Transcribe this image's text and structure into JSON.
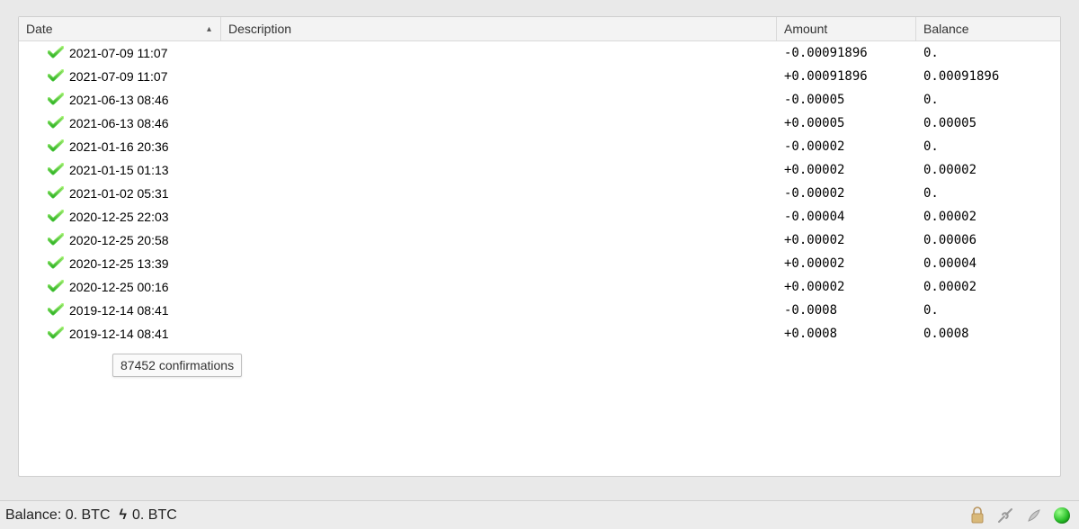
{
  "columns": {
    "date": "Date",
    "description": "Description",
    "amount": "Amount",
    "balance": "Balance"
  },
  "transactions": [
    {
      "date": "2021-07-09 11:07",
      "description": "",
      "amount": "-0.00091896",
      "negative": true,
      "balance": "0."
    },
    {
      "date": "2021-07-09 11:07",
      "description": "",
      "amount": "+0.00091896",
      "negative": false,
      "balance": "0.00091896"
    },
    {
      "date": "2021-06-13 08:46",
      "description": "",
      "amount": "-0.00005",
      "negative": true,
      "balance": "0."
    },
    {
      "date": "2021-06-13 08:46",
      "description": "",
      "amount": "+0.00005",
      "negative": false,
      "balance": "0.00005"
    },
    {
      "date": "2021-01-16 20:36",
      "description": "",
      "amount": "-0.00002",
      "negative": true,
      "balance": "0."
    },
    {
      "date": "2021-01-15 01:13",
      "description": "",
      "amount": "+0.00002",
      "negative": false,
      "balance": "0.00002"
    },
    {
      "date": "2021-01-02 05:31",
      "description": "",
      "amount": "-0.00002",
      "negative": true,
      "balance": "0."
    },
    {
      "date": "2020-12-25 22:03",
      "description": "",
      "amount": "-0.00004",
      "negative": true,
      "balance": "0.00002"
    },
    {
      "date": "2020-12-25 20:58",
      "description": "",
      "amount": "+0.00002",
      "negative": false,
      "balance": "0.00006"
    },
    {
      "date": "2020-12-25 13:39",
      "description": "",
      "amount": "+0.00002",
      "negative": false,
      "balance": "0.00004"
    },
    {
      "date": "2020-12-25 00:16",
      "description": "",
      "amount": "+0.00002",
      "negative": false,
      "balance": "0.00002"
    },
    {
      "date": "2019-12-14 08:41",
      "description": "",
      "amount": "-0.0008",
      "negative": true,
      "balance": "0."
    },
    {
      "date": "2019-12-14 08:41",
      "description": "",
      "amount": "+0.0008",
      "negative": false,
      "balance": "0.0008"
    }
  ],
  "tooltip": "87452 confirmations",
  "statusbar": {
    "balance_label": "Balance:",
    "balance_value": "0. BTC",
    "lightning_value": "0. BTC"
  },
  "icons": {
    "confirmed": "check-icon",
    "lock": "lock-icon",
    "tools": "tools-icon",
    "seed": "seed-icon",
    "network": "network-orb"
  }
}
